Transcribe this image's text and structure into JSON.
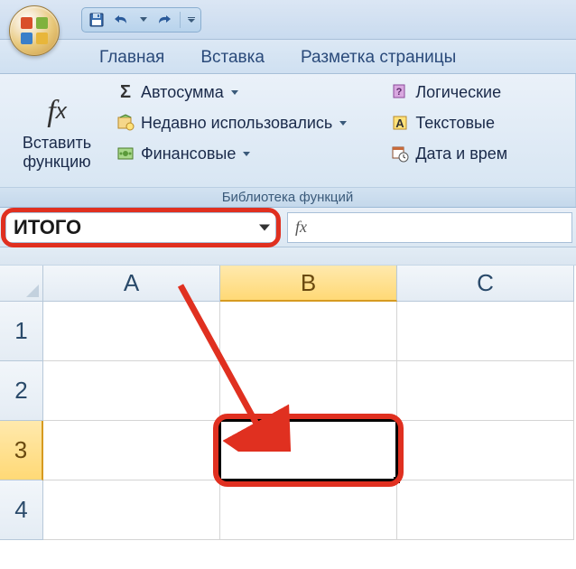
{
  "qat": {
    "save_icon": "save-icon",
    "undo_icon": "undo-icon",
    "redo_icon": "redo-icon"
  },
  "tabs": {
    "home": "Главная",
    "insert": "Вставка",
    "page_layout": "Разметка страницы"
  },
  "ribbon": {
    "insert_function": {
      "line1": "Вставить",
      "line2": "функцию"
    },
    "autosum": "Автосумма",
    "recent": "Недавно использовались",
    "financial": "Финансовые",
    "logical": "Логические",
    "text": "Текстовые",
    "datetime": "Дата и врем",
    "group_label": "Библиотека функций"
  },
  "namebox": {
    "value": "ИТОГО"
  },
  "formula_bar": {
    "fx_label": "fx",
    "value": ""
  },
  "columns": [
    "A",
    "B",
    "C"
  ],
  "rows": [
    "1",
    "2",
    "3",
    "4"
  ],
  "active_cell": {
    "col": "B",
    "row": "3"
  }
}
